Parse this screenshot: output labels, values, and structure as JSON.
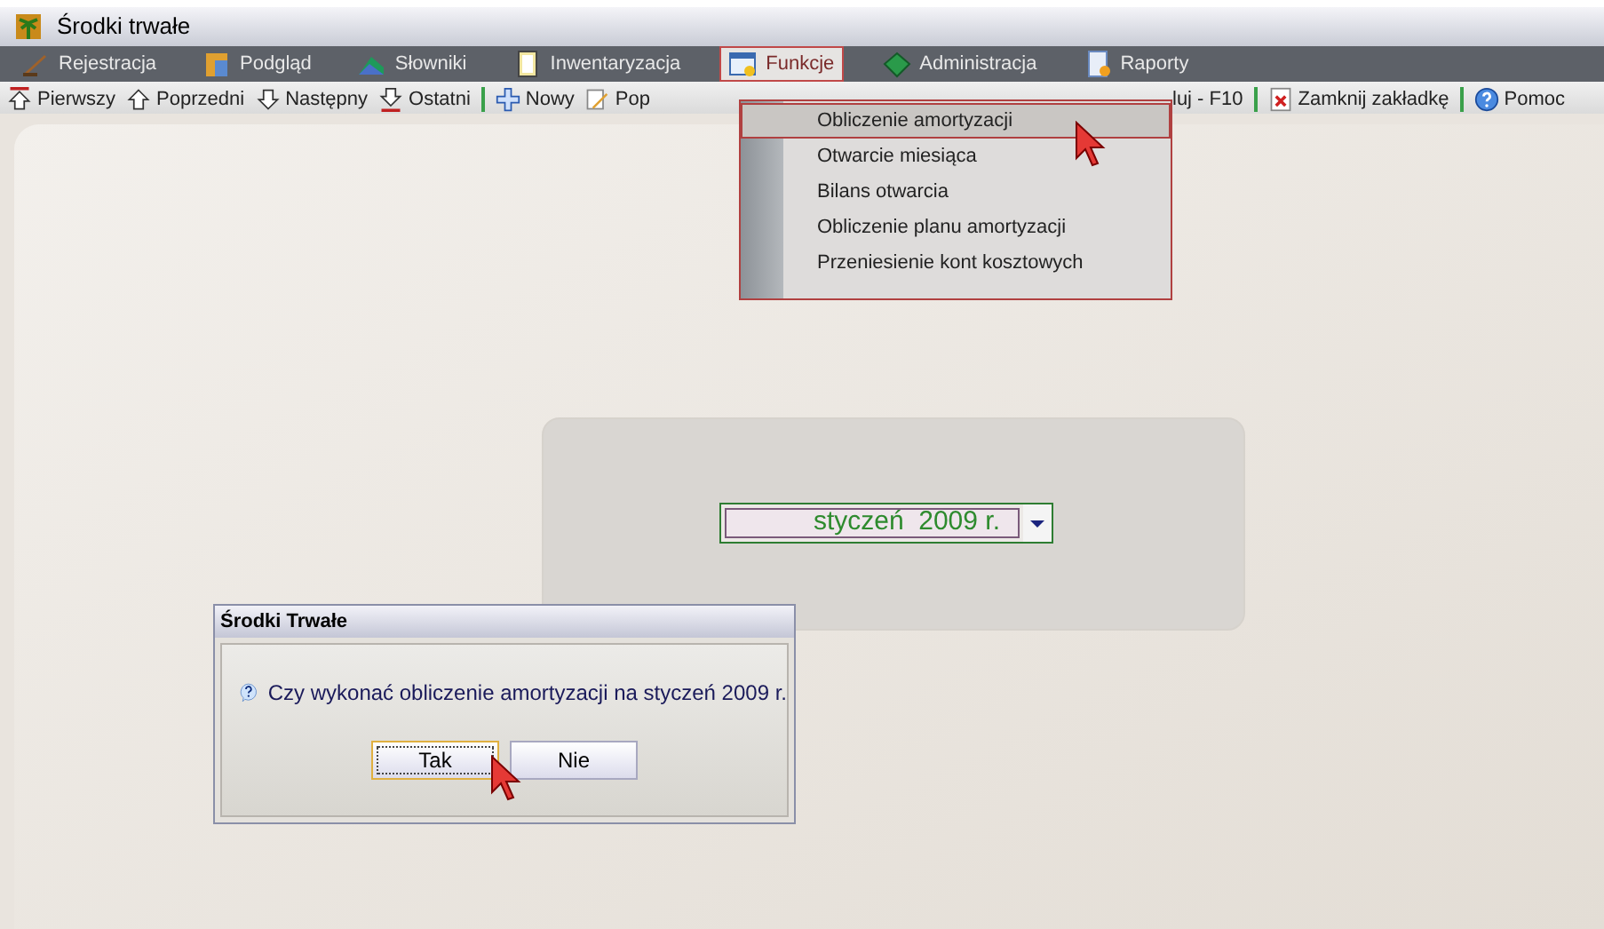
{
  "window": {
    "title": "Środki trwałe"
  },
  "menu": [
    {
      "label": "Rejestracja",
      "selected": false
    },
    {
      "label": "Podgląd",
      "selected": false
    },
    {
      "label": "Słowniki",
      "selected": false
    },
    {
      "label": "Inwentaryzacja",
      "selected": false
    },
    {
      "label": "Funkcje",
      "selected": true
    },
    {
      "label": "Administracja",
      "selected": false
    },
    {
      "label": "Raporty",
      "selected": false
    }
  ],
  "toolbar_left": [
    {
      "label": "Pierwszy"
    },
    {
      "label": "Poprzedni"
    },
    {
      "label": "Następny"
    },
    {
      "label": "Ostatni"
    },
    {
      "label": "Nowy",
      "separator": true
    },
    {
      "label": "Pop"
    }
  ],
  "toolbar_right": [
    {
      "label": "luj - F10"
    },
    {
      "label": "Zamknij zakładkę",
      "separator": true
    },
    {
      "label": "Pomoc",
      "separator": true
    }
  ],
  "dropdown": [
    {
      "label": "Obliczenie amortyzacji",
      "selected": true
    },
    {
      "label": "Otwarcie miesiąca",
      "selected": false
    },
    {
      "label": "Bilans otwarcia",
      "selected": false
    },
    {
      "label": "Obliczenie planu amortyzacji",
      "selected": false
    },
    {
      "label": "Przeniesienie kont kosztowych",
      "selected": false
    }
  ],
  "month_select": {
    "value": "styczeń  2009 r."
  },
  "dialog": {
    "title": "Środki Trwałe",
    "message": "Czy wykonać obliczenie amortyzacji na styczeń 2009 r.",
    "buttons": [
      {
        "label": "Tak",
        "selected": true
      },
      {
        "label": "Nie",
        "selected": false
      }
    ]
  }
}
